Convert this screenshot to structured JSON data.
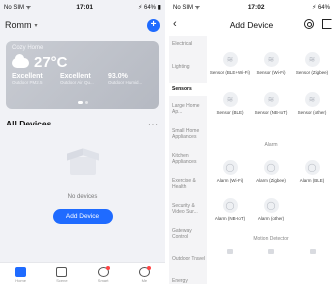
{
  "left": {
    "status": {
      "carrier": "No SIM ᯤ",
      "time": "17:01",
      "battery": "⚡ 64% ▮"
    },
    "home_name": "Romm",
    "caret": "▾",
    "add_icon": "+",
    "weather": {
      "location": "Cozy Home",
      "temperature": "27°C",
      "stats": [
        {
          "value": "Excellent",
          "label": "Outdoor PM2.5"
        },
        {
          "value": "Excellent",
          "label": "Outdoor Air Qu..."
        },
        {
          "value": "93.0%",
          "label": "Outdoor Humid..."
        }
      ]
    },
    "devices_title": "All Devices",
    "more": "···",
    "empty_text": "No devices",
    "add_device_label": "Add Device",
    "tabs": [
      {
        "label": "Home",
        "icon": "home-icon"
      },
      {
        "label": "Scene",
        "icon": "scene-icon"
      },
      {
        "label": "Smart",
        "icon": "smart-icon"
      },
      {
        "label": "Me",
        "icon": "me-icon"
      }
    ]
  },
  "right": {
    "status": {
      "carrier": "No SIM ᯤ",
      "time": "17:02",
      "battery": "⚡ 64%"
    },
    "back_icon": "‹",
    "title": "Add Device",
    "categories": [
      "Electrical",
      "Lighting",
      "Sensors",
      "Large Home Ap...",
      "Small Home Appliances",
      "Kitchen Appliances",
      "Exercise & Health",
      "Security & Video Sur...",
      "Gateway Control",
      "Outdoor Travel",
      "Energy"
    ],
    "selected_category": "Sensors",
    "devices": [
      {
        "label": "Sensor (BLE+Wi-Fi)",
        "icon": "wave"
      },
      {
        "label": "Sensor (Wi-Fi)",
        "icon": "wave"
      },
      {
        "label": "Sensor (Zigbee)",
        "icon": "wave"
      },
      {
        "label": "Sensor (BLE)",
        "icon": "wave"
      },
      {
        "label": "Sensor (NB-IoT)",
        "icon": "wave"
      },
      {
        "label": "Sensor (other)",
        "icon": "wave"
      },
      {
        "label": "Alarm (Wi-Fi)",
        "icon": "alarm"
      },
      {
        "label": "Alarm (Zigbee)",
        "icon": "alarm"
      },
      {
        "label": "Alarm (BLE)",
        "icon": "alarm"
      },
      {
        "label": "Alarm (NB-IoT)",
        "icon": "alarm"
      },
      {
        "label": "Alarm (other)",
        "icon": "alarm"
      }
    ],
    "group_alarm": "Alarm",
    "group_motion": "Motion Detector"
  }
}
